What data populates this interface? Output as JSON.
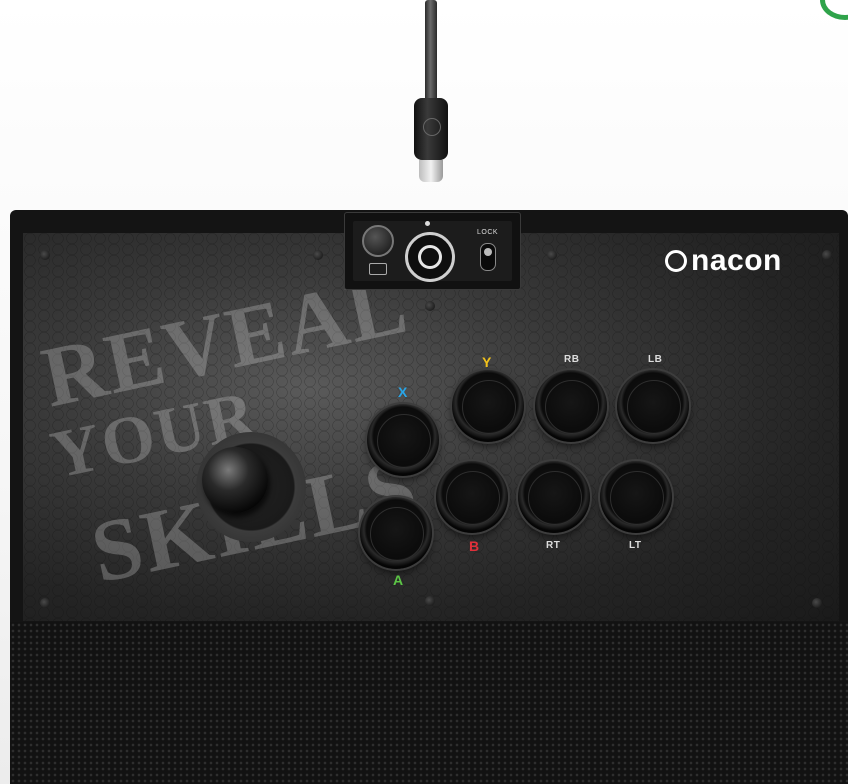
{
  "device": {
    "brand": "nacon",
    "art_words": [
      "REVEAL",
      "YOUR",
      "SKILLS"
    ],
    "lock_label": "LOCK",
    "buttons": [
      {
        "id": "x",
        "label": "X",
        "color": "#2aa6e8"
      },
      {
        "id": "y",
        "label": "Y",
        "color": "#f2c21b"
      },
      {
        "id": "rb",
        "label": "RB",
        "color": "#dddddd"
      },
      {
        "id": "lb",
        "label": "LB",
        "color": "#dddddd"
      },
      {
        "id": "a",
        "label": "A",
        "color": "#5cc546"
      },
      {
        "id": "b",
        "label": "B",
        "color": "#e0303a"
      },
      {
        "id": "rt",
        "label": "RT",
        "color": "#dddddd"
      },
      {
        "id": "lt",
        "label": "LT",
        "color": "#dddddd"
      }
    ]
  },
  "icons": {
    "xbox": "xbox-logo-icon",
    "brand": "nacon-logo-icon",
    "cable": "usb-c-cable-icon"
  }
}
